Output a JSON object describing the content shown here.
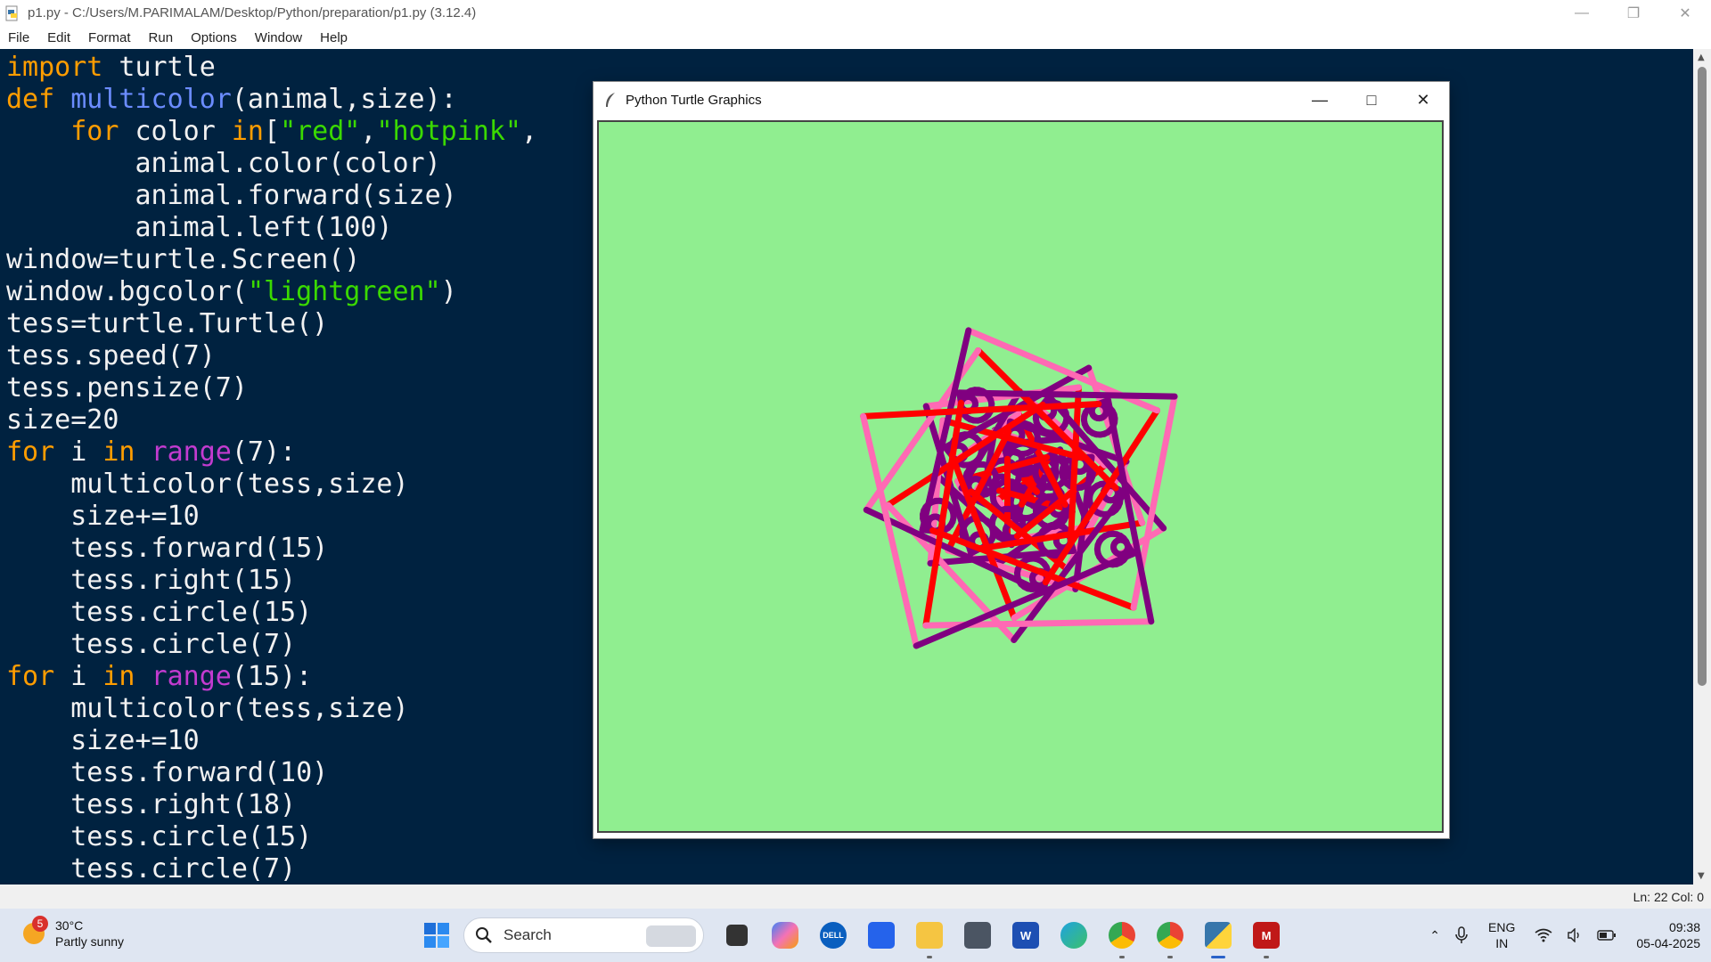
{
  "titlebar": {
    "title": "p1.py - C:/Users/M.PARIMALAM/Desktop/Python/preparation/p1.py (3.12.4)",
    "minimize_icon": "minimize-icon",
    "maximize_icon": "restore-icon",
    "close_icon": "close-icon"
  },
  "menu": [
    "File",
    "Edit",
    "Format",
    "Run",
    "Options",
    "Window",
    "Help"
  ],
  "code_colors": {
    "background": "#002240",
    "keyword": "#ff9d00",
    "function": "#6b8cff",
    "string": "#3ad900",
    "builtin": "#c33bd0",
    "text": "#f2f2f2"
  },
  "code": [
    [
      [
        "kw",
        "import"
      ],
      [
        "t",
        " turtle"
      ]
    ],
    [
      [
        "kw",
        "def"
      ],
      [
        "t",
        " "
      ],
      [
        "fn",
        "multicolor"
      ],
      [
        "t",
        "(animal,size):"
      ]
    ],
    [
      [
        "t",
        "    "
      ],
      [
        "kw",
        "for"
      ],
      [
        "t",
        " color "
      ],
      [
        "kw",
        "in"
      ],
      [
        "t",
        "["
      ],
      [
        "str",
        "\"red\""
      ],
      [
        "t",
        ","
      ],
      [
        "str",
        "\"hotpink\""
      ],
      [
        "t",
        ","
      ]
    ],
    [
      [
        "t",
        "        animal.color(color)"
      ]
    ],
    [
      [
        "t",
        "        animal.forward(size)"
      ]
    ],
    [
      [
        "t",
        "        animal.left(100)"
      ]
    ],
    [
      [
        "t",
        "window=turtle.Screen()"
      ]
    ],
    [
      [
        "t",
        "window.bgcolor("
      ],
      [
        "str",
        "\"lightgreen\""
      ],
      [
        "t",
        ")"
      ]
    ],
    [
      [
        "t",
        "tess=turtle.Turtle()"
      ]
    ],
    [
      [
        "t",
        "tess.speed(7)"
      ]
    ],
    [
      [
        "t",
        "tess.pensize(7)"
      ]
    ],
    [
      [
        "t",
        "size=20"
      ]
    ],
    [
      [
        "kw",
        "for"
      ],
      [
        "t",
        " i "
      ],
      [
        "kw",
        "in"
      ],
      [
        "t",
        " "
      ],
      [
        "bi",
        "range"
      ],
      [
        "t",
        "(7):"
      ]
    ],
    [
      [
        "t",
        "    multicolor(tess,size)"
      ]
    ],
    [
      [
        "t",
        "    size+=10"
      ]
    ],
    [
      [
        "t",
        "    tess.forward(15)"
      ]
    ],
    [
      [
        "t",
        "    tess.right(15)"
      ]
    ],
    [
      [
        "t",
        "    tess.circle(15)"
      ]
    ],
    [
      [
        "t",
        "    tess.circle(7)"
      ]
    ],
    [
      [
        "kw",
        "for"
      ],
      [
        "t",
        " i "
      ],
      [
        "kw",
        "in"
      ],
      [
        "t",
        " "
      ],
      [
        "bi",
        "range"
      ],
      [
        "t",
        "(15):"
      ]
    ],
    [
      [
        "t",
        "    multicolor(tess,size)"
      ]
    ],
    [
      [
        "t",
        "    size+=10"
      ]
    ],
    [
      [
        "t",
        "    tess.forward(10)"
      ]
    ],
    [
      [
        "t",
        "    tess.right(18)"
      ]
    ],
    [
      [
        "t",
        "    tess.circle(15)"
      ]
    ],
    [
      [
        "t",
        "    tess.circle(7)"
      ]
    ]
  ],
  "status": {
    "position": "Ln: 22   Col: 0"
  },
  "turtle_window": {
    "title": "Python Turtle Graphics",
    "canvas_bg": "#90ee90",
    "pen_colors": [
      "#ff0000",
      "#ff69b4",
      "#800080",
      "#000000"
    ],
    "pen_size": 7
  },
  "taskbar": {
    "weather_badge": "5",
    "temperature": "30°C",
    "condition": "Partly sunny",
    "search_placeholder": "Search",
    "apps": [
      "start-icon",
      "search-icon",
      "task-view-icon",
      "copilot-icon",
      "dell-icon",
      "store-icon",
      "file-explorer-icon",
      "camera-icon",
      "word-icon",
      "edge-icon",
      "chrome-icon",
      "chrome-profile-icon",
      "python-icon",
      "mcafee-icon"
    ],
    "lang_line1": "ENG",
    "lang_line2": "IN",
    "time": "09:38",
    "date": "05-04-2025"
  }
}
